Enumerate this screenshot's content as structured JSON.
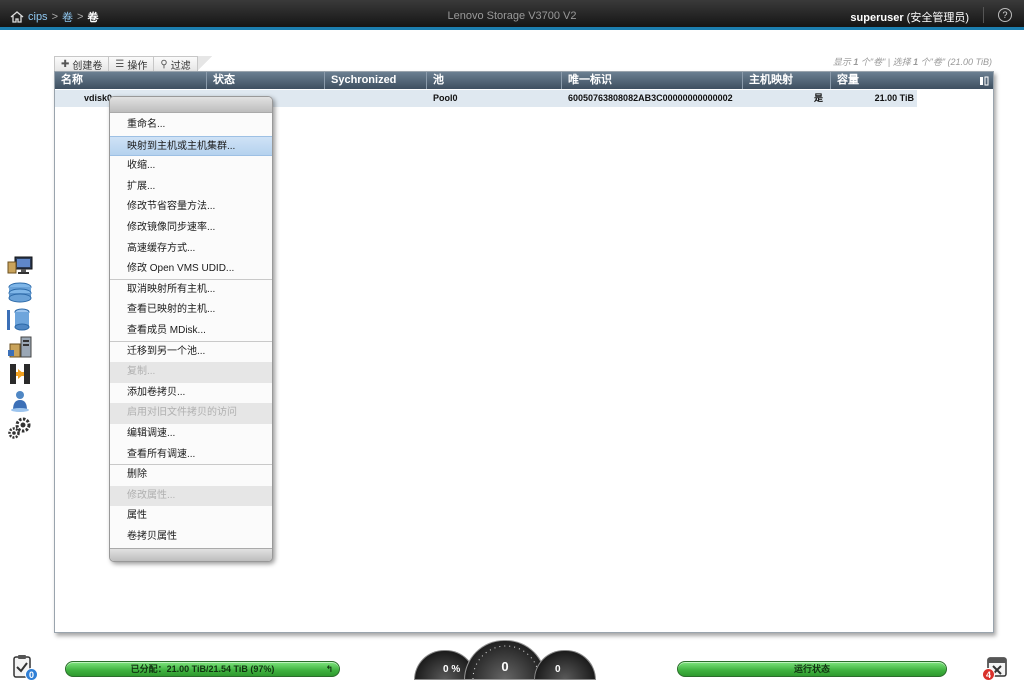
{
  "header": {
    "breadcrumb": [
      "cips",
      "卷",
      "卷"
    ],
    "breadcrumb_sep": ">",
    "product": "Lenovo Storage V3700 V2",
    "user_name": "superuser",
    "user_role": "(安全管理员)",
    "help_label": "?"
  },
  "toolbar": {
    "create_label": "创建卷",
    "actions_label": "操作",
    "filter_label": "过滤"
  },
  "selection_info": {
    "prefix": "显示 ",
    "shown": "1",
    "mid1": " 个\"卷\" | 选择 ",
    "selected": "1",
    "mid2": " 个\"卷\" (21.00 TiB)"
  },
  "table": {
    "columns": [
      "名称",
      "状态",
      "Sychronized",
      "池",
      "唯一标识",
      "主机映射",
      "容量"
    ],
    "rows": [
      {
        "name": "vdisk0",
        "status": "",
        "synchronized": "",
        "pool": "Pool0",
        "uid": "60050763808082AB3C00000000000002",
        "host_mapping": "是",
        "capacity": "21.00 TiB"
      }
    ]
  },
  "context_menu": {
    "items": [
      {
        "label": "重命名...",
        "state": "normal"
      },
      {
        "label": "映射到主机或主机集群...",
        "state": "highlight"
      },
      {
        "label": "收缩...",
        "state": "normal"
      },
      {
        "label": "扩展...",
        "state": "normal"
      },
      {
        "label": "修改节省容量方法...",
        "state": "normal"
      },
      {
        "label": "修改镜像同步速率...",
        "state": "normal"
      },
      {
        "label": "高速缓存方式...",
        "state": "normal"
      },
      {
        "label": "修改 Open VMS UDID...",
        "state": "normal",
        "sep": true
      },
      {
        "label": "取消映射所有主机...",
        "state": "normal"
      },
      {
        "label": "查看已映射的主机...",
        "state": "normal"
      },
      {
        "label": "查看成员 MDisk...",
        "state": "normal",
        "sep": true
      },
      {
        "label": "迁移到另一个池...",
        "state": "normal"
      },
      {
        "label": "复制...",
        "state": "disabled"
      },
      {
        "label": "添加卷拷贝...",
        "state": "normal"
      },
      {
        "label": "启用对旧文件拷贝的访问",
        "state": "disabled"
      },
      {
        "label": "编辑调速...",
        "state": "normal"
      },
      {
        "label": "查看所有调速...",
        "state": "normal",
        "sep": true
      },
      {
        "label": "删除",
        "state": "normal"
      },
      {
        "label": "修改属性...",
        "state": "disabled"
      },
      {
        "label": "属性",
        "state": "normal"
      },
      {
        "label": "卷拷贝属性",
        "state": "normal"
      }
    ]
  },
  "status_bar": {
    "allocation_text": "已分配：21.00 TiB/21.54 TiB (97%)",
    "allocation_percent": 97,
    "gauge_left": "0 %",
    "gauge_mid": "0",
    "gauge_right": "0",
    "health_text": "运行状态",
    "left_badge_count": "0",
    "right_badge_count": "4"
  },
  "colors": {
    "accent": "#1c7fb0",
    "header_grad_top": "#6b7f91",
    "row_selected": "#dfe8f0",
    "status_green": "#3fb13f",
    "alert_red": "#d9312b",
    "info_blue": "#2f7fd6"
  },
  "sidebar_icons": [
    "monitoring-icon",
    "pools-icon",
    "volumes-icon",
    "hosts-icon",
    "copy-services-icon",
    "access-icon",
    "settings-icon"
  ]
}
